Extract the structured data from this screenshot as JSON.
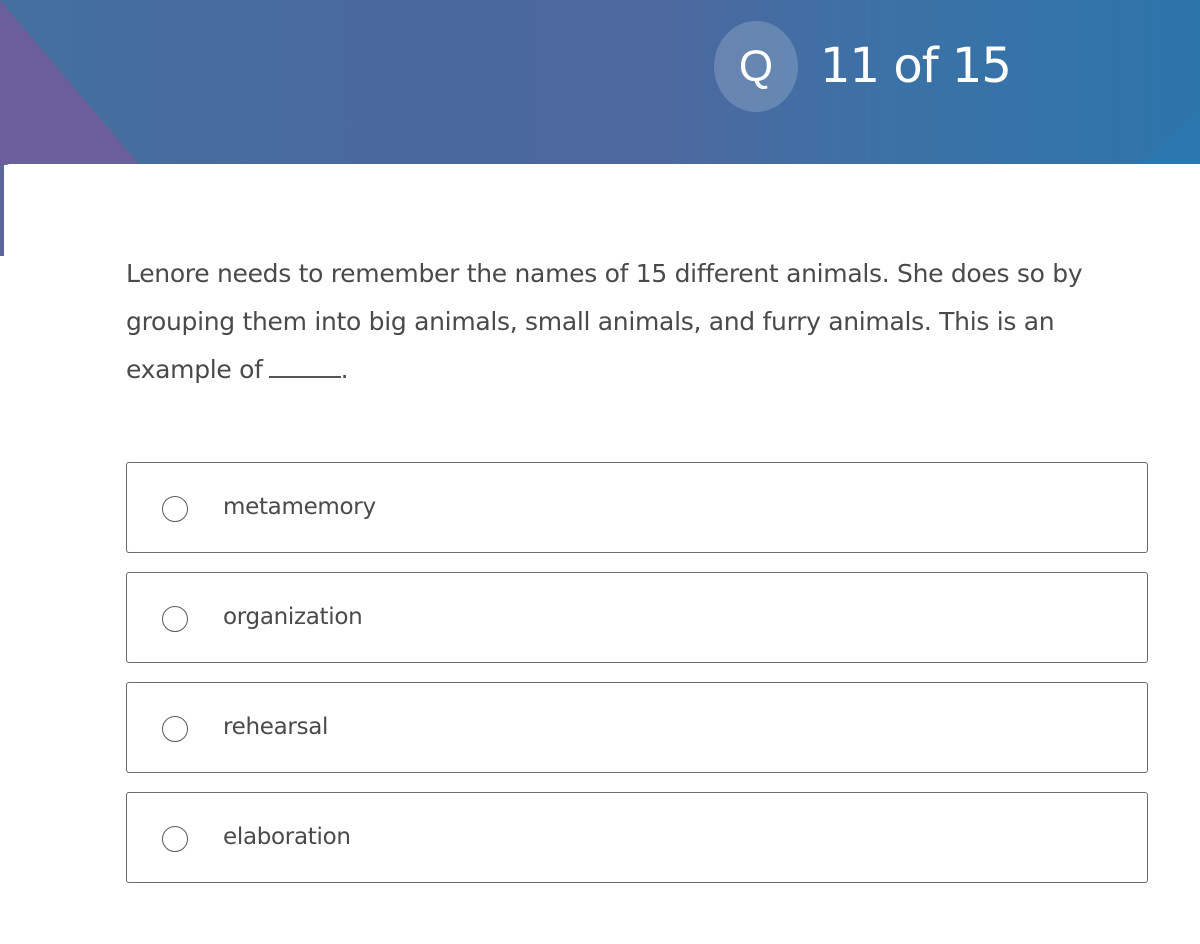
{
  "header": {
    "badge_letter": "Q",
    "progress_text": "11 of 15",
    "current_question": 11,
    "total_questions": 15,
    "colors": {
      "header_blue": "#43709f",
      "accent_purple": "#6a5e9b"
    }
  },
  "question": {
    "text": "Lenore needs to remember the names of 15 different animals. She does so by grouping them into big animals, small animals, and furry animals. This is an example of",
    "trailing": "."
  },
  "options": [
    {
      "label": "metamemory",
      "selected": false
    },
    {
      "label": "organization",
      "selected": false
    },
    {
      "label": "rehearsal",
      "selected": false
    },
    {
      "label": "elaboration",
      "selected": false
    }
  ]
}
